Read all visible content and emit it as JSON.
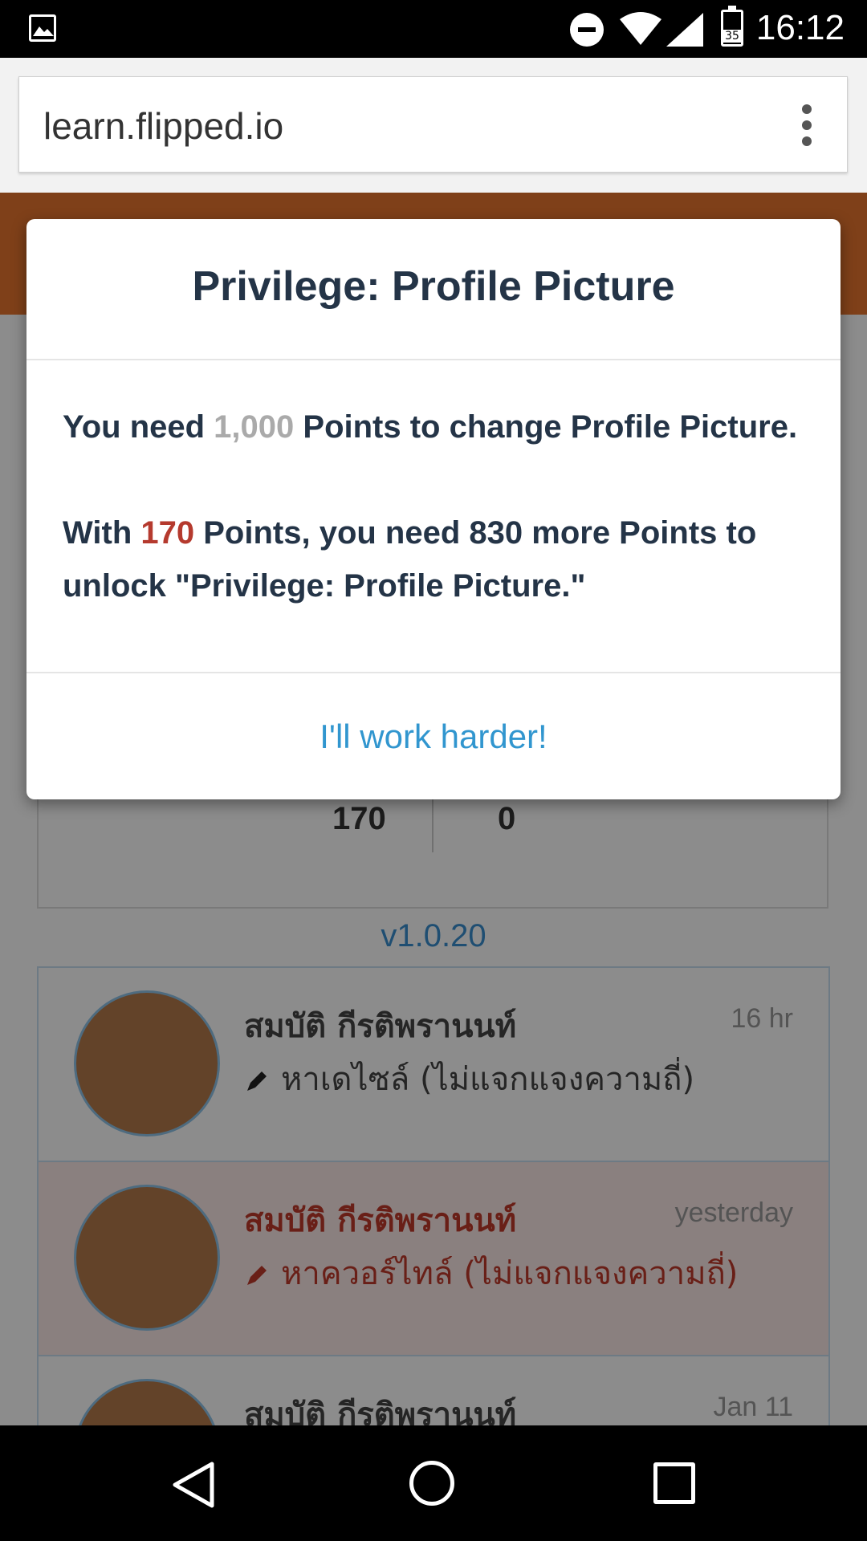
{
  "status_bar": {
    "time": "16:12",
    "battery": "35"
  },
  "browser": {
    "url": "learn.flipped.io"
  },
  "page": {
    "stats": [
      "170",
      "0"
    ],
    "version": "v1.0.20",
    "feed": [
      {
        "name": "สมบัติ กีรติพรานนท์",
        "time": "16 hr",
        "text": "หาเดไซล์ (ไม่แจกแจงความถี่)"
      },
      {
        "name": "สมบัติ กีรติพรานนท์",
        "time": "yesterday",
        "text": "หาควอร์ไทล์ (ไม่แจกแจงความถี่)"
      },
      {
        "name": "สมบัติ กีรติพรานนท์",
        "time": "Jan 11",
        "text": ""
      }
    ]
  },
  "modal": {
    "title": "Privilege: Profile Picture",
    "line1_pre": "You need ",
    "line1_points": "1,000",
    "line1_post": " Points to change Profile Picture.",
    "line2_pre": "With ",
    "line2_points": "170",
    "line2_post": " Points, you need 830 more Points to unlock \"Privilege: Profile Picture.\"",
    "button": "I'll work harder!"
  }
}
